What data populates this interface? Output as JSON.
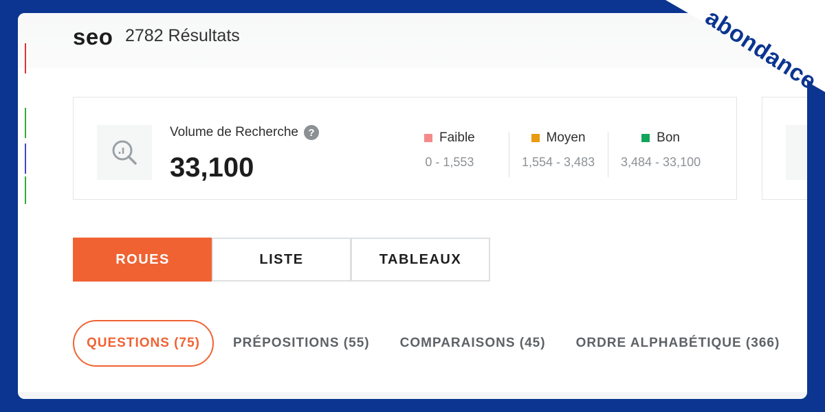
{
  "header": {
    "keyword": "seo",
    "results": "2782 Résultats"
  },
  "metric": {
    "label": "Volume de Recherche",
    "help": "?",
    "value": "33,100",
    "icon": "search-chart-icon"
  },
  "legend": [
    {
      "name": "Faible",
      "range": "0 - 1,553",
      "color": "#f58a8a"
    },
    {
      "name": "Moyen",
      "range": "1,554 - 3,483",
      "color": "#e89a10"
    },
    {
      "name": "Bon",
      "range": "3,484 - 33,100",
      "color": "#12a55b"
    }
  ],
  "views": [
    "ROUES",
    "LISTE",
    "TABLEAUX"
  ],
  "tabs": [
    "QUESTIONS (75)",
    "PRÉPOSITIONS (55)",
    "COMPARAISONS (45)",
    "ORDRE ALPHABÉTIQUE (366)"
  ],
  "logo": "abondance",
  "colors": {
    "accent": "#f06232",
    "frame": "#0b3590"
  }
}
